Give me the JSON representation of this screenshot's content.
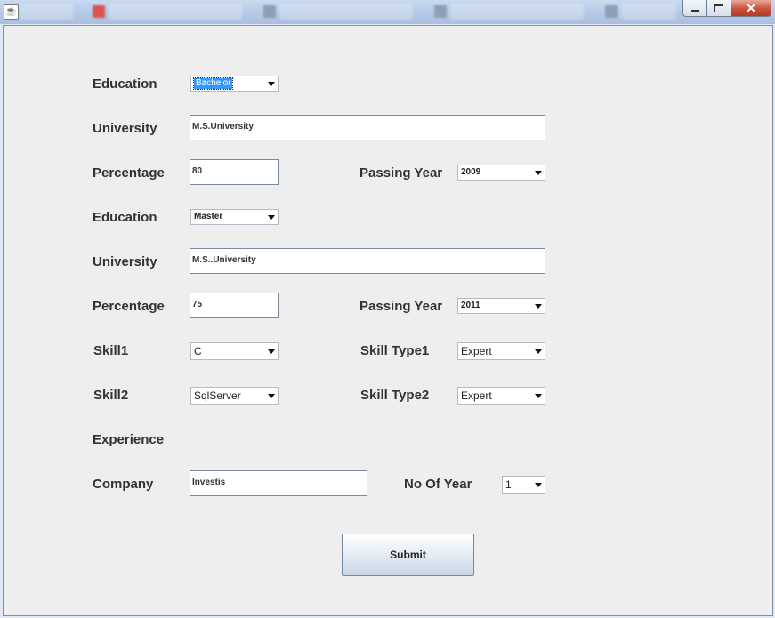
{
  "window": {
    "title": "",
    "buttons": {
      "minimize": "",
      "maximize": "",
      "close": "✕"
    }
  },
  "form": {
    "education1": {
      "label": "Education",
      "value": "Bachelor"
    },
    "university1": {
      "label": "University",
      "value": "M.S.University"
    },
    "percentage1": {
      "label": "Percentage",
      "value": "80"
    },
    "passing_year1": {
      "label": "Passing Year",
      "value": "2009"
    },
    "education2": {
      "label": "Education",
      "value": "Master"
    },
    "university2": {
      "label": "University",
      "value": "M.S..University"
    },
    "percentage2": {
      "label": "Percentage",
      "value": "75"
    },
    "passing_year2": {
      "label": "Passing Year",
      "value": "2011"
    },
    "skill1": {
      "label": "Skill1",
      "value": "C"
    },
    "skill_type1": {
      "label": "Skill Type1",
      "value": "Expert"
    },
    "skill2": {
      "label": "Skill2",
      "value": "SqlServer"
    },
    "skill_type2": {
      "label": "Skill Type2",
      "value": "Expert"
    },
    "experience": {
      "label": "Experience"
    },
    "company": {
      "label": "Company",
      "value": "Investis"
    },
    "no_of_year": {
      "label": "No Of Year",
      "value": "1"
    },
    "submit_label": "Submit"
  }
}
